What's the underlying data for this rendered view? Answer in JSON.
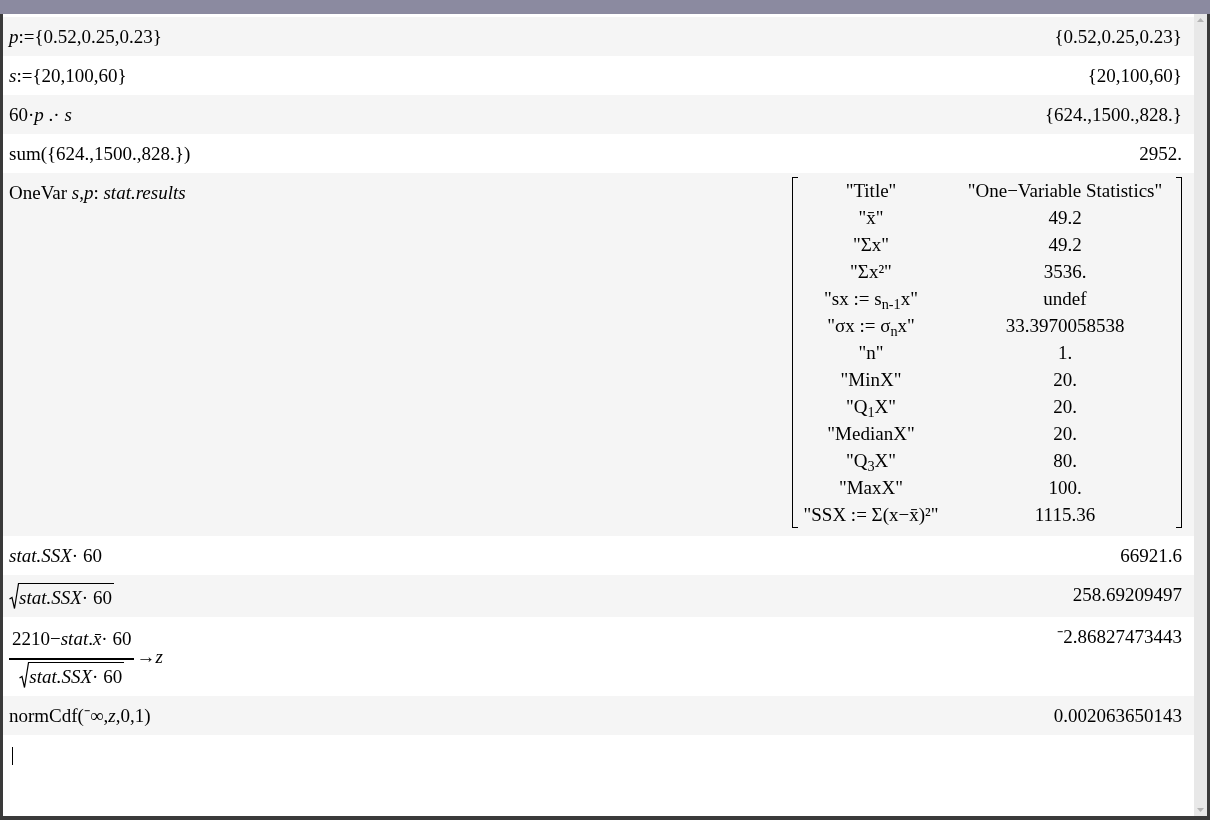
{
  "entries": [
    {
      "input": {
        "kind": "text",
        "text": "*p*:={0.52,0.25,0.23}"
      },
      "output": {
        "kind": "text",
        "text": "{0.52,0.25,0.23}"
      }
    },
    {
      "input": {
        "kind": "text",
        "text": "*s*:={20,100,60}"
      },
      "output": {
        "kind": "text",
        "text": "{20,100,60}"
      }
    },
    {
      "input": {
        "kind": "text",
        "text": "60·*p* .· *s*"
      },
      "output": {
        "kind": "text",
        "text": "{624.,1500.,828.}"
      }
    },
    {
      "input": {
        "kind": "text",
        "text": "sum({624.,1500.,828.})"
      },
      "output": {
        "kind": "text",
        "text": "2952."
      }
    },
    {
      "input": {
        "kind": "text",
        "text": "OneVar *s*,*p*: *stat.results*"
      },
      "output": {
        "kind": "matrix",
        "rows": [
          [
            "\"Title\"",
            "\"One−Variable Statistics\""
          ],
          [
            "\"x̄\"",
            "49.2"
          ],
          [
            "\"Σx\"",
            "49.2"
          ],
          [
            "\"Σx²\"",
            "3536."
          ],
          [
            "\"sx := s$_{n-1}$x\"",
            "undef"
          ],
          [
            "\"σx := σ$_{n}$x\"",
            "33.3970058538"
          ],
          [
            "\"n\"",
            "1."
          ],
          [
            "\"MinX\"",
            "20."
          ],
          [
            "\"Q$_{1}$X\"",
            "20."
          ],
          [
            "\"MedianX\"",
            "20."
          ],
          [
            "\"Q$_{3}$X\"",
            "80."
          ],
          [
            "\"MaxX\"",
            "100."
          ],
          [
            "\"SSX := Σ(x−x̄)²\"",
            "1115.36"
          ]
        ]
      }
    },
    {
      "input": {
        "kind": "text",
        "text": "*stat.SSX*· 60"
      },
      "output": {
        "kind": "text",
        "text": "66921.6"
      }
    },
    {
      "input": {
        "kind": "sqrt",
        "text": "*stat.SSX*· 60"
      },
      "output": {
        "kind": "text",
        "text": "258.69209497"
      }
    },
    {
      "input": {
        "kind": "fraction",
        "numerator": {
          "kind": "text",
          "text": "2210−*stat*.*x̄*· 60"
        },
        "denominator": {
          "kind": "sqrt",
          "text": "*stat.SSX*· 60"
        },
        "suffix": "→*z*"
      },
      "output": {
        "kind": "text",
        "text": "⁻2.86827473443"
      }
    },
    {
      "input": {
        "kind": "text",
        "text": "normCdf(⁻∞,*z*,0,1)"
      },
      "output": {
        "kind": "text",
        "text": "0.002063650143"
      }
    }
  ],
  "new_entry": {
    "focused": true
  }
}
